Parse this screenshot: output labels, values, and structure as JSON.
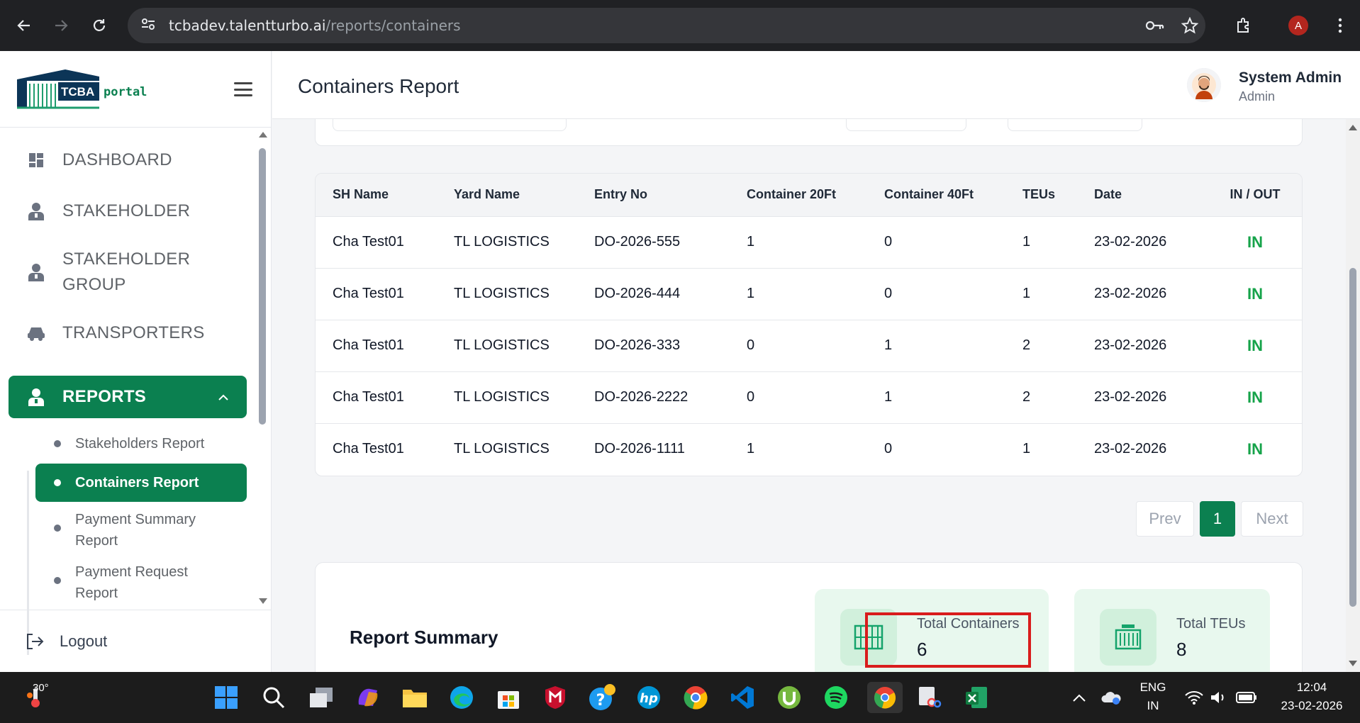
{
  "browser": {
    "url_domain": "tcbadev.talentturbo.ai",
    "url_path": "/reports/containers",
    "profile_initial": "A"
  },
  "sidebar": {
    "logo_text_1": "TCBA",
    "logo_text_2": "portal",
    "items": [
      {
        "label": "DASHBOARD"
      },
      {
        "label": "STAKEHOLDER"
      },
      {
        "label": "STAKEHOLDER GROUP"
      },
      {
        "label": "TRANSPORTERS"
      },
      {
        "label": "REPORTS"
      }
    ],
    "sub_items": [
      {
        "label": "Stakeholders Report"
      },
      {
        "label": "Containers Report"
      },
      {
        "label": "Payment Summary Report"
      },
      {
        "label": "Payment Request Report"
      }
    ],
    "logout": "Logout"
  },
  "header": {
    "title": "Containers Report",
    "user_name": "System Admin",
    "user_role": "Admin"
  },
  "table": {
    "columns": [
      "SH Name",
      "Yard Name",
      "Entry No",
      "Container 20Ft",
      "Container 40Ft",
      "TEUs",
      "Date",
      "IN / OUT"
    ],
    "rows": [
      [
        "Cha Test01",
        "TL LOGISTICS",
        "DO-2026-555",
        "1",
        "0",
        "1",
        "23-02-2026",
        "IN"
      ],
      [
        "Cha Test01",
        "TL LOGISTICS",
        "DO-2026-444",
        "1",
        "0",
        "1",
        "23-02-2026",
        "IN"
      ],
      [
        "Cha Test01",
        "TL LOGISTICS",
        "DO-2026-333",
        "0",
        "1",
        "2",
        "23-02-2026",
        "IN"
      ],
      [
        "Cha Test01",
        "TL LOGISTICS",
        "DO-2026-2222",
        "0",
        "1",
        "2",
        "23-02-2026",
        "IN"
      ],
      [
        "Cha Test01",
        "TL LOGISTICS",
        "DO-2026-1111",
        "1",
        "0",
        "1",
        "23-02-2026",
        "IN"
      ]
    ]
  },
  "pagination": {
    "prev": "Prev",
    "current": "1",
    "next": "Next"
  },
  "summary": {
    "title": "Report Summary",
    "total_containers_label": "Total Containers",
    "total_containers_value": "6",
    "total_teus_label": "Total TEUs",
    "total_teus_value": "8"
  },
  "taskbar": {
    "weather_temp": "30°",
    "lang_1": "ENG",
    "lang_2": "IN",
    "time": "12:04",
    "date": "23-02-2026"
  },
  "colors": {
    "brand_green": "#0b8050",
    "in_green": "#16a34a",
    "highlight_red": "#d91c1c"
  }
}
